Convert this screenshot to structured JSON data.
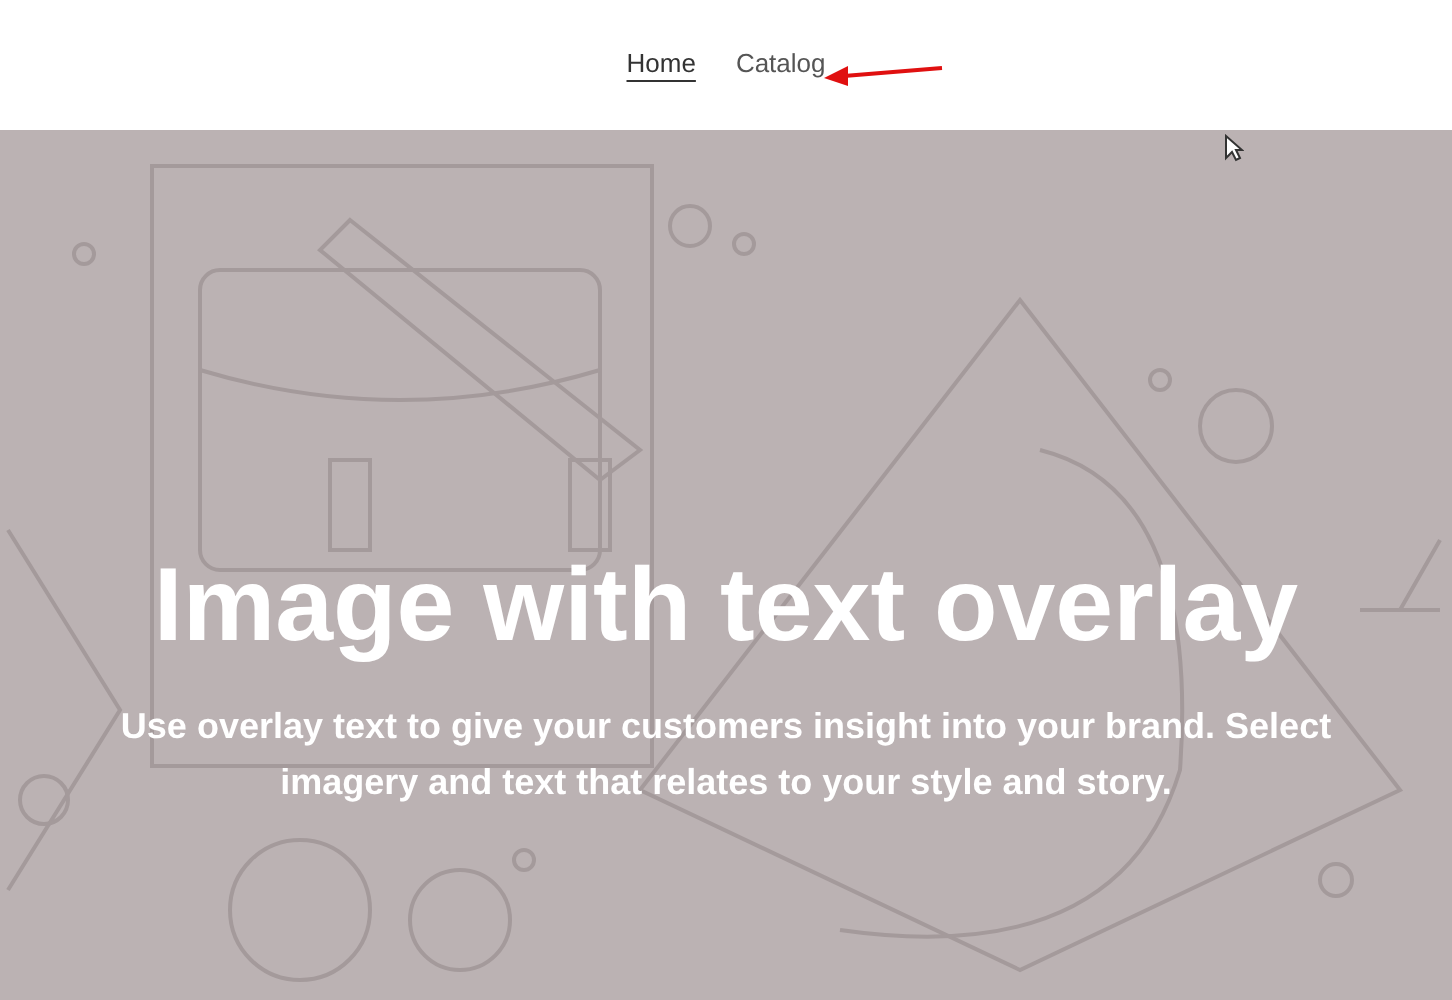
{
  "nav": {
    "links": [
      {
        "label": "Home",
        "selected": true
      },
      {
        "label": "Catalog",
        "selected": false
      }
    ]
  },
  "hero": {
    "title": "Image with text overlay",
    "text": "Use overlay text to give your customers insight into your brand. Select imagery and text that relates to your style and story."
  }
}
